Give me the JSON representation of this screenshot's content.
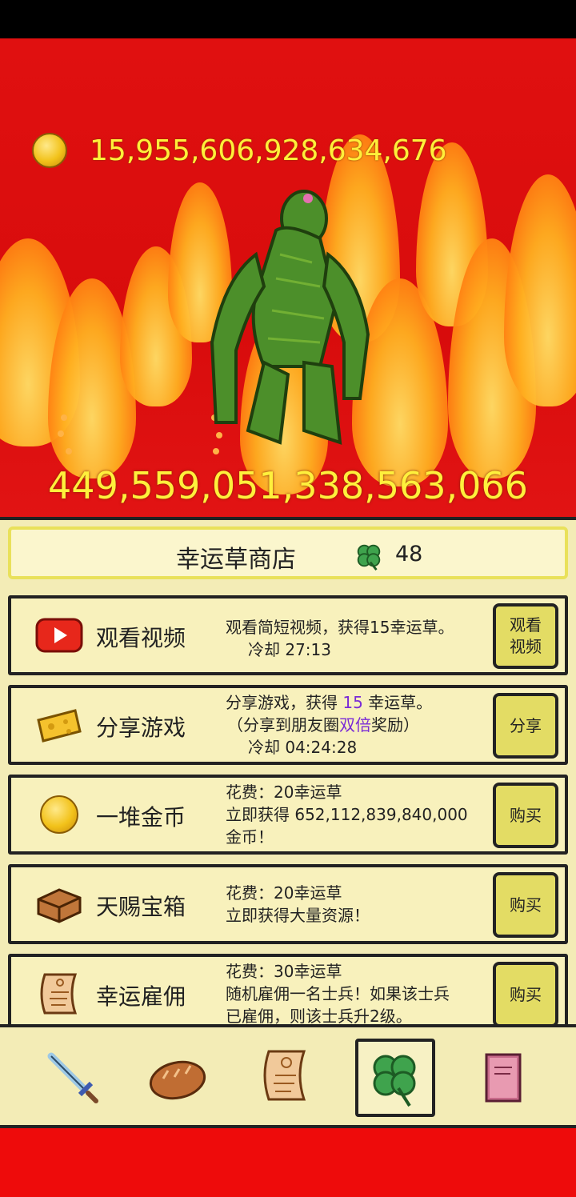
{
  "gold": {
    "amount": "15,955,606,928,634,676",
    "icon": "gold-coin-icon"
  },
  "monster": {
    "hp": "449,559,051,338,563,066",
    "icon": "green-swamp-monster"
  },
  "shop": {
    "title": "幸运草商店",
    "clover_count": "48",
    "clover_icon": "clover-icon"
  },
  "rows": [
    {
      "icon": "video-play-icon",
      "name": "观看视频",
      "desc": [
        "观看简短视频，获得15幸运草。",
        "冷却 27:13"
      ],
      "button": [
        "观看",
        "视频"
      ]
    },
    {
      "icon": "cheese-icon",
      "name": "分享游戏",
      "desc_a": "分享游戏，获得 ",
      "desc_b": "15",
      "desc_c": " 幸运草。",
      "desc_d": "（分享到朋友圈",
      "desc_e": "双倍",
      "desc_f": "奖励）",
      "desc_g": "冷却 04:24:28",
      "button": "分享"
    },
    {
      "icon": "gold-coin-icon",
      "name": "一堆金币",
      "desc": [
        "花费：20幸运草",
        "立即获得 652,112,839,840,000",
        "金币！"
      ],
      "button": "购买"
    },
    {
      "icon": "treasure-chest-icon",
      "name": "天赐宝箱",
      "desc": [
        "花费：20幸运草",
        "立即获得大量资源！"
      ],
      "button": "购买"
    },
    {
      "icon": "scroll-icon",
      "name": "幸运雇佣",
      "desc": [
        "花费：30幸运草",
        "随机雇佣一名士兵！如果该士兵",
        "已雇佣，则该士兵升2级。"
      ],
      "button": "购买"
    }
  ],
  "nav": [
    {
      "icon": "sword-icon",
      "active": false
    },
    {
      "icon": "bread-icon",
      "active": false
    },
    {
      "icon": "scroll-icon",
      "active": false
    },
    {
      "icon": "clover-icon",
      "active": true
    },
    {
      "icon": "book-icon",
      "active": false
    }
  ],
  "colors": {
    "background": "#e01010",
    "gold_text": "#ffef3a",
    "panel": "#f3ecb6",
    "button": "#e3dc64",
    "highlight_text": "#7a2bd6"
  }
}
